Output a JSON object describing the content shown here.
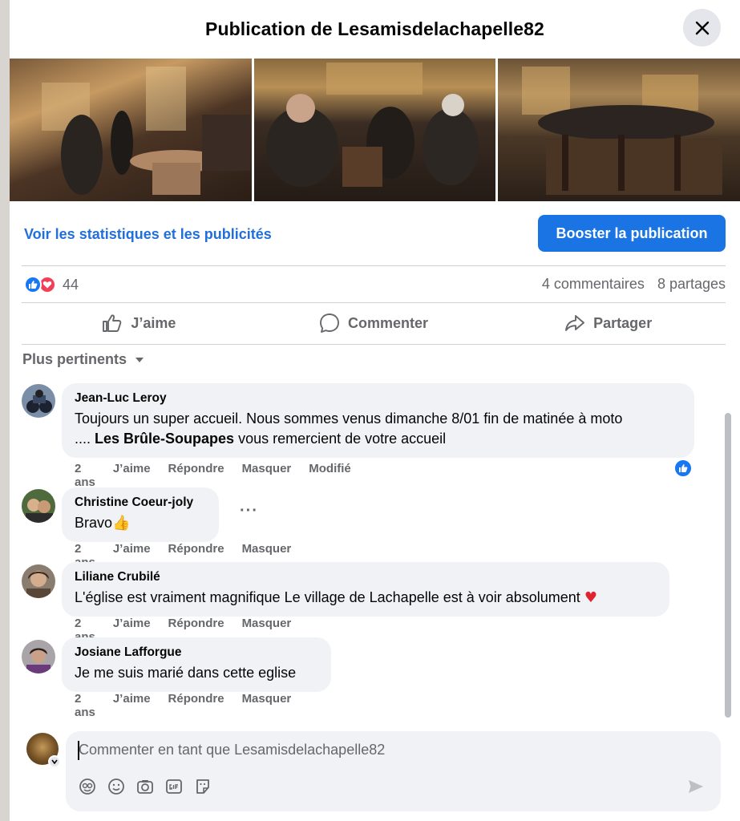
{
  "header": {
    "title": "Publication de Lesamisdelachapelle82"
  },
  "stats_link": "Voir les statistiques et les publicités",
  "boost_button": "Booster la publication",
  "reactions": {
    "count": "44",
    "comments": "4 commentaires",
    "shares": "8 partages"
  },
  "actions": {
    "like": "J’aime",
    "comment": "Commenter",
    "share": "Partager"
  },
  "sort": {
    "label": "Plus pertinents"
  },
  "comments": [
    {
      "author": "Jean-Luc Leroy",
      "text_line1": "Toujours un super accueil. Nous sommes venus dimanche 8/01 fin de matinée à moto",
      "text_pre": ".... ",
      "text_bold": "Les Brûle-Soupapes",
      "text_post": " vous remercient de votre accueil",
      "time": "2 ans",
      "like": "J’aime",
      "reply": "Répondre",
      "hide": "Masquer",
      "edited": "Modifié"
    },
    {
      "author": "Christine Coeur-joly",
      "text": "Bravo",
      "emoji": "👍",
      "time": "2 ans",
      "like": "J’aime",
      "reply": "Répondre",
      "hide": "Masquer"
    },
    {
      "author": "Liliane Crubilé",
      "text": "L'église est vraiment magnifique Le village de Lachapelle est à voir absolument",
      "emoji": "♥",
      "time": "2 ans",
      "like": "J’aime",
      "reply": "Répondre",
      "hide": "Masquer"
    },
    {
      "author": "Josiane Lafforgue",
      "text": "Je me suis marié dans cette eglise",
      "time": "2 ans",
      "like": "J’aime",
      "reply": "Répondre",
      "hide": "Masquer"
    }
  ],
  "composer": {
    "placeholder": "Commenter en tant que Lesamisdelachapelle82"
  },
  "colors": {
    "accent": "#1b74e4",
    "link": "#216fdb",
    "love": "#f33e58",
    "muted": "#65676b",
    "bubble": "#f0f2f5"
  }
}
